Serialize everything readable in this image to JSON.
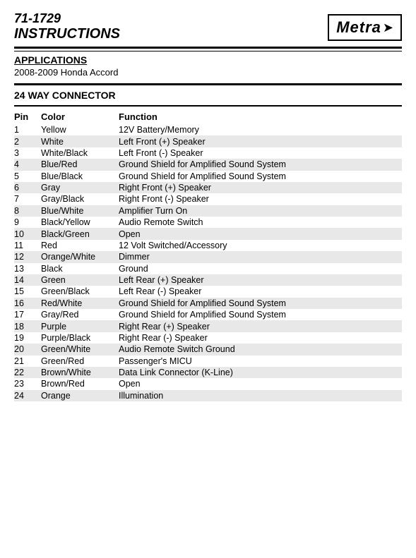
{
  "header": {
    "model": "71-1729",
    "instructions_label": "INSTRUCTIONS",
    "logo_text": "Metra",
    "logo_arrow": "⚡"
  },
  "sections": {
    "applications": {
      "title": "APPLICATIONS",
      "vehicle": "2008-2009 Honda Accord"
    },
    "connector": {
      "title": "24 WAY CONNECTOR",
      "columns": {
        "pin": "Pin",
        "color": "Color",
        "function": "Function"
      },
      "rows": [
        {
          "pin": "1",
          "color": "Yellow",
          "function": "12V Battery/Memory"
        },
        {
          "pin": "2",
          "color": "White",
          "function": "Left Front (+) Speaker"
        },
        {
          "pin": "3",
          "color": "White/Black",
          "function": "Left Front (-) Speaker"
        },
        {
          "pin": "4",
          "color": "Blue/Red",
          "function": "Ground Shield for Amplified Sound System"
        },
        {
          "pin": "5",
          "color": "Blue/Black",
          "function": "Ground Shield for Amplified Sound System"
        },
        {
          "pin": "6",
          "color": "Gray",
          "function": "Right Front  (+) Speaker"
        },
        {
          "pin": "7",
          "color": "Gray/Black",
          "function": "Right Front  (-) Speaker"
        },
        {
          "pin": "8",
          "color": "Blue/White",
          "function": "Amplifier Turn On"
        },
        {
          "pin": "9",
          "color": "Black/Yellow",
          "function": "Audio Remote Switch"
        },
        {
          "pin": "10",
          "color": "Black/Green",
          "function": "Open"
        },
        {
          "pin": "11",
          "color": "Red",
          "function": "12 Volt Switched/Accessory"
        },
        {
          "pin": "12",
          "color": "Orange/White",
          "function": "Dimmer"
        },
        {
          "pin": "13",
          "color": "Black",
          "function": "Ground"
        },
        {
          "pin": "14",
          "color": "Green",
          "function": "Left Rear (+) Speaker"
        },
        {
          "pin": "15",
          "color": "Green/Black",
          "function": "Left Rear (-) Speaker"
        },
        {
          "pin": "16",
          "color": "Red/White",
          "function": "Ground Shield for Amplified Sound System"
        },
        {
          "pin": "17",
          "color": "Gray/Red",
          "function": "Ground Shield for Amplified Sound System"
        },
        {
          "pin": "18",
          "color": "Purple",
          "function": "Right Rear (+) Speaker"
        },
        {
          "pin": "19",
          "color": "Purple/Black",
          "function": "Right Rear (-) Speaker"
        },
        {
          "pin": "20",
          "color": "Green/White",
          "function": "Audio Remote Switch Ground"
        },
        {
          "pin": "21",
          "color": "Green/Red",
          "function": "Passenger's MICU"
        },
        {
          "pin": "22",
          "color": "Brown/White",
          "function": "Data Link Connector (K-Line)"
        },
        {
          "pin": "23",
          "color": "Brown/Red",
          "function": "Open"
        },
        {
          "pin": "24",
          "color": "Orange",
          "function": "Illumination"
        }
      ]
    }
  }
}
